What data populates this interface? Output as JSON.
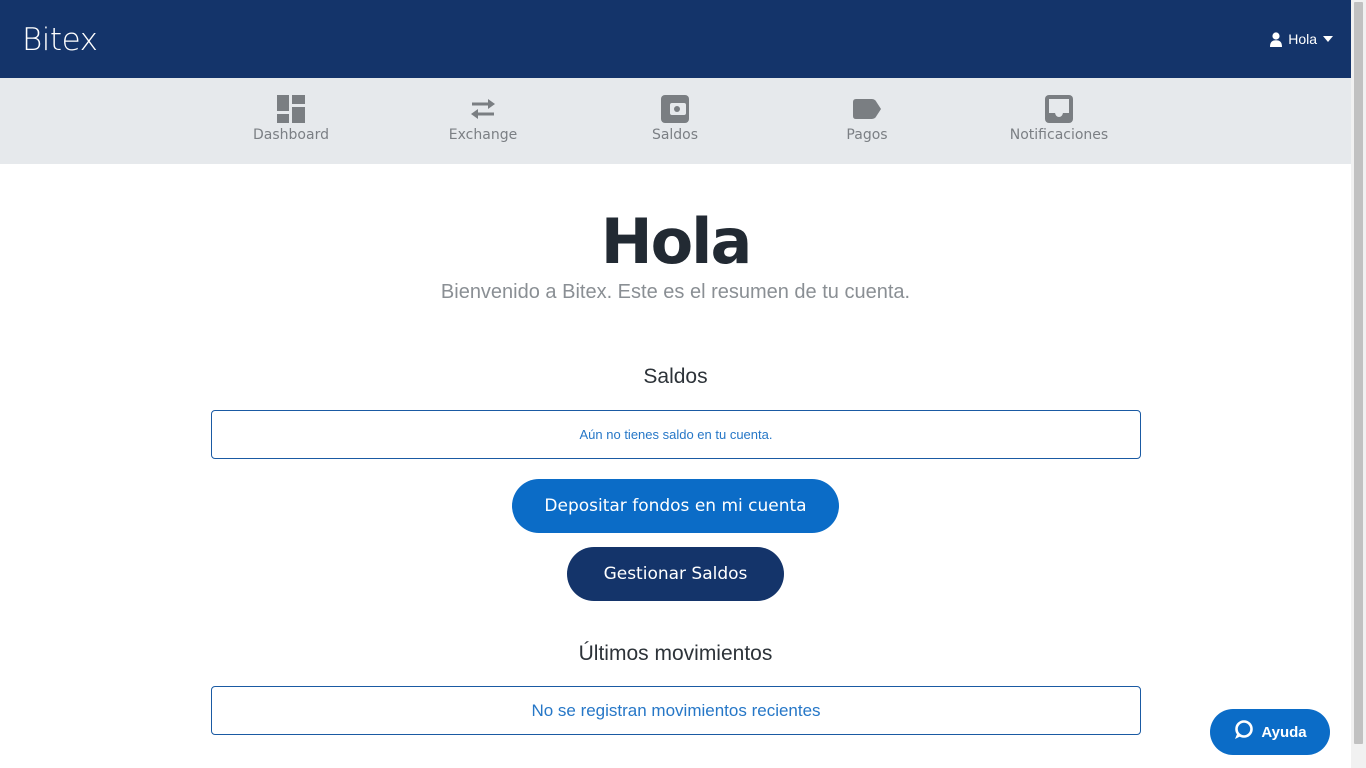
{
  "header": {
    "brand": "Bitex",
    "user_menu_label": "Hola"
  },
  "nav": {
    "items": [
      {
        "label": "Dashboard",
        "icon": "dashboard-icon"
      },
      {
        "label": "Exchange",
        "icon": "exchange-icon"
      },
      {
        "label": "Saldos",
        "icon": "wallet-icon"
      },
      {
        "label": "Pagos",
        "icon": "tag-icon"
      },
      {
        "label": "Notificaciones",
        "icon": "inbox-icon"
      }
    ]
  },
  "hero": {
    "title": "Hola",
    "subtitle": "Bienvenido a Bitex. Este es el resumen de tu cuenta."
  },
  "balances": {
    "title": "Saldos",
    "empty_message": "Aún no tienes saldo en tu cuenta.",
    "deposit_button": "Depositar fondos en mi cuenta",
    "manage_button": "Gestionar Saldos"
  },
  "movements": {
    "title": "Últimos movimientos",
    "empty_message": "No se registran movimientos recientes"
  },
  "help": {
    "label": "Ayuda"
  },
  "colors": {
    "header_bg": "#14346a",
    "subnav_bg": "#e6e9ec",
    "primary_button": "#0b6cc7",
    "dark_button": "#14346a",
    "empty_text": "#2677c7"
  }
}
